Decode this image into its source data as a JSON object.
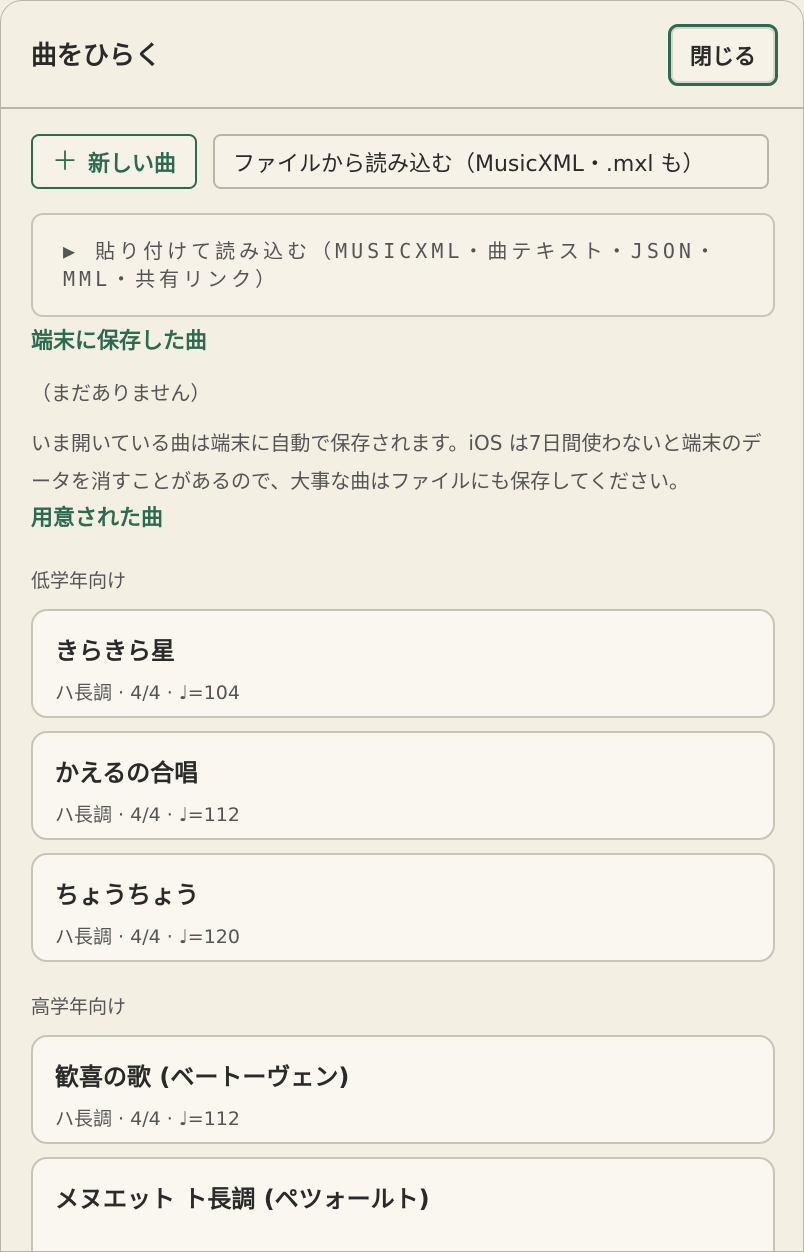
{
  "header": {
    "title": "曲をひらく",
    "close_label": "閉じる"
  },
  "actions": {
    "new_song_label": "新しい曲",
    "load_file_label": "ファイルから読み込む（MusicXML・.mxl も）",
    "paste_label": "▶ 貼り付けて読み込む（MUSICXML・曲テキスト・JSON・MML・共有リンク）"
  },
  "saved": {
    "heading": "端末に保存した曲",
    "empty_text": "（まだありません）",
    "note": "いま開いている曲は端末に自動で保存されます。iOS は7日間使わないと端末のデータを消すことがあるので、大事な曲はファイルにも保存してください。"
  },
  "presets": {
    "heading": "用意された曲",
    "groups": [
      {
        "label": "低学年向け",
        "songs": [
          {
            "title": "きらきら星",
            "meta": "ハ長調 · 4/4 · ♩=104"
          },
          {
            "title": "かえるの合唱",
            "meta": "ハ長調 · 4/4 · ♩=112"
          },
          {
            "title": "ちょうちょう",
            "meta": "ハ長調 · 4/4 · ♩=120"
          }
        ]
      },
      {
        "label": "高学年向け",
        "songs": [
          {
            "title": "歓喜の歌 (ベートーヴェン)",
            "meta": "ハ長調 · 4/4 · ♩=112"
          },
          {
            "title": "メヌエット ト長調 (ペツォールト)",
            "meta": ""
          }
        ]
      }
    ]
  }
}
